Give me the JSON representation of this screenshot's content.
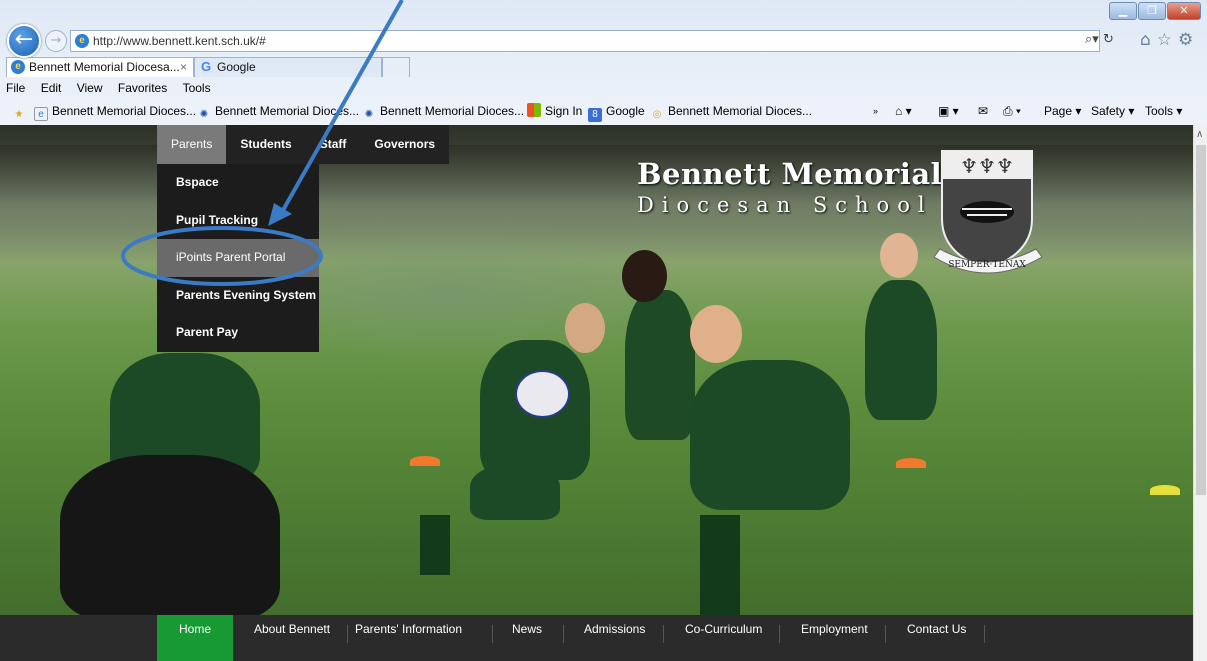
{
  "browser": {
    "address": "http://www.bennett.kent.sch.uk/#",
    "tabs": [
      {
        "label": "Bennett Memorial Diocesa..."
      },
      {
        "label": "Google"
      }
    ],
    "menu": [
      "File",
      "Edit",
      "View",
      "Favorites",
      "Tools"
    ],
    "favorites": [
      "Bennett Memorial Dioces...",
      "Bennett Memorial Dioces...",
      "Bennett Memorial Dioces...",
      "Sign In",
      "Google",
      "Bennett Memorial Dioces..."
    ],
    "commands": [
      "Page ▾",
      "Safety ▾",
      "Tools ▾"
    ]
  },
  "site": {
    "top_nav": [
      "Parents",
      "Students",
      "Staff",
      "Governors"
    ],
    "dropdown": [
      "Bspace",
      "Pupil Tracking",
      "iPoints Parent Portal",
      "Parents Evening System",
      "Parent Pay"
    ],
    "logo_line1": "Bennett Memorial",
    "logo_line2": "Diocesan School",
    "crest_motto": "SEMPER·TENAX",
    "footer_nav": [
      "Home",
      "About Bennett",
      "Parents' Information",
      "News",
      "Admissions",
      "Co-Curriculum",
      "Employment",
      "Contact Us"
    ]
  },
  "colors": {
    "footer_active": "#179a33",
    "annotation": "#3b7ac4"
  }
}
